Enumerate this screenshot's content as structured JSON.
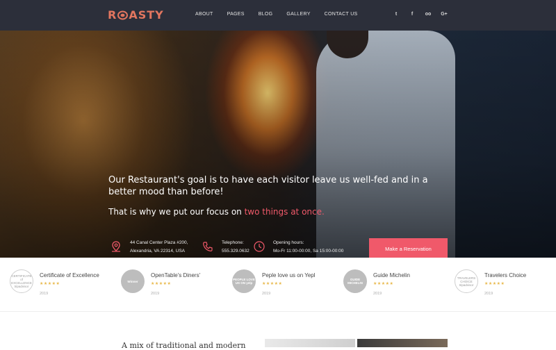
{
  "brand": {
    "logo": "ROASTY",
    "logo_pre": "R",
    "logo_post": "ASTY",
    "accent_color": "#f0596a",
    "nav_bg": "#2c2f3a"
  },
  "nav": {
    "items": [
      "ABOUT",
      "PAGES",
      "BLOG",
      "GALLERY",
      "CONTACT US"
    ],
    "social": [
      "twitter-icon",
      "facebook-icon",
      "tripadvisor-icon",
      "google-plus-icon"
    ],
    "social_glyphs": [
      "t",
      "f",
      "oo",
      "G+"
    ]
  },
  "hero": {
    "tagline": "Our Restaurant's goal is to have each visitor leave us well-fed and in a better mood than before!",
    "subline_pre": "That is why we put our focus on ",
    "subline_accent": "two things at once.",
    "address_line1": "44 Canal Center Plaza #200,",
    "address_line2": "Alexandria, VA 22314, USA",
    "phone_label": "Telephone:",
    "phone_value": "555.329.0632",
    "hours_label": "Opening hours:",
    "hours_value": "Mo-Fr 11:00-00:00, Sa 15:00-00:00",
    "cta": "Make a Reservation"
  },
  "awards": [
    {
      "name": "Certificate of Excellence",
      "year": "2019",
      "stars": "★★★★★",
      "badge": "CERTIFICATE of EXCELLENCE tripadvisor"
    },
    {
      "name": "OpenTable's Diners'",
      "year": "2019",
      "stars": "★★★★★",
      "badge": "Winner"
    },
    {
      "name": "Peple love us on Yepl",
      "year": "2019",
      "stars": "★★★★★",
      "badge": "PEOPLE LOVE US ON yelp"
    },
    {
      "name": "Guide Michelin",
      "year": "2019",
      "stars": "★★★★★",
      "badge": "GUIDE MICHELIN"
    },
    {
      "name": "Travelers Choice",
      "year": "2019",
      "stars": "★★★★★",
      "badge": "TRAVELERS CHOICE tripadvisor"
    }
  ],
  "bottom": {
    "heading": "A mix of traditional and modern"
  }
}
